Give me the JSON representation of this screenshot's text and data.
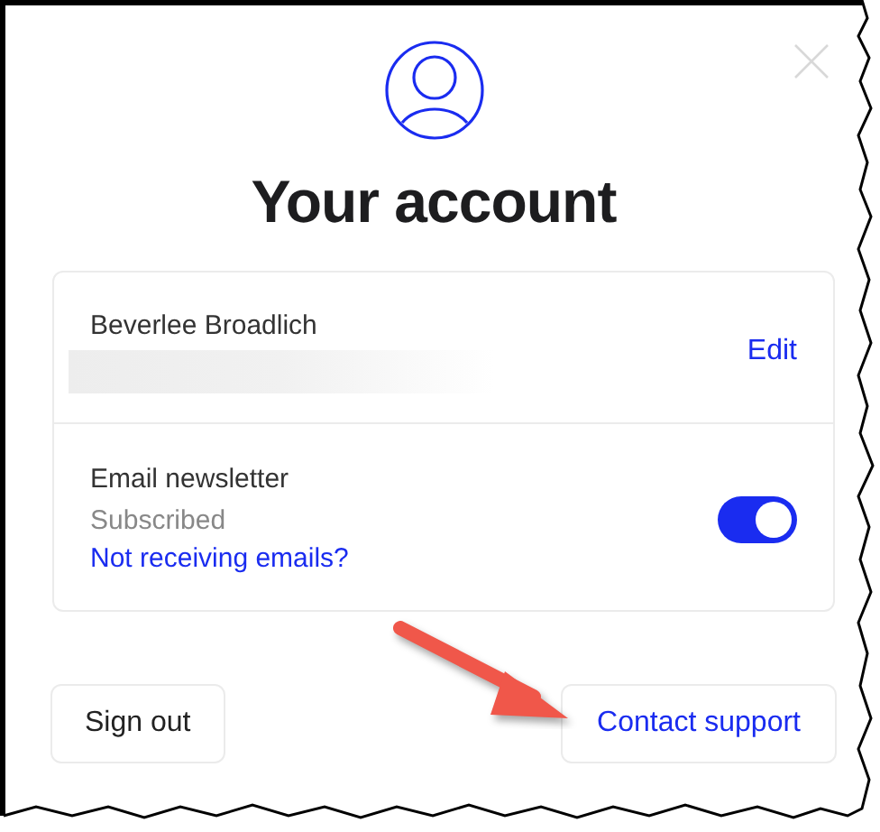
{
  "title": "Your account",
  "profile": {
    "name": "Beverlee Broadlich",
    "edit_link": "Edit"
  },
  "newsletter": {
    "label": "Email newsletter",
    "status": "Subscribed",
    "help_link": "Not receiving emails?",
    "on": true
  },
  "buttons": [
    {
      "label": "Sign out",
      "kind": "plain"
    },
    {
      "label": "Contact support",
      "kind": "link"
    }
  ]
}
